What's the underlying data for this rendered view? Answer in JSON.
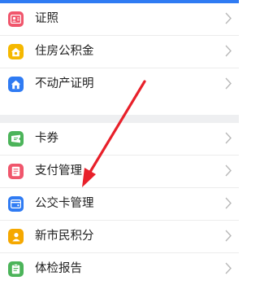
{
  "colors": {
    "accent_bar": "#2f7bf3",
    "annotation_arrow": "#e8202a",
    "separator": "#eeeff1"
  },
  "section1": {
    "items": [
      {
        "label": "证照",
        "icon": "id-card-icon",
        "color": "#f0566c"
      },
      {
        "label": "住房公积金",
        "icon": "house-fund-icon",
        "color": "#f5b800"
      },
      {
        "label": "不动产证明",
        "icon": "home-icon",
        "color": "#2f7bf3"
      }
    ]
  },
  "section2": {
    "items": [
      {
        "label": "卡券",
        "icon": "ticket-icon",
        "color": "#4cb45a"
      },
      {
        "label": "支付管理",
        "icon": "document-icon",
        "color": "#f0566c"
      },
      {
        "label": "公交卡管理",
        "icon": "wallet-card-icon",
        "color": "#2f7bf3"
      },
      {
        "label": "新市民积分",
        "icon": "person-icon",
        "color": "#f5a800"
      },
      {
        "label": "体检报告",
        "icon": "report-icon",
        "color": "#4cb45a"
      }
    ]
  }
}
